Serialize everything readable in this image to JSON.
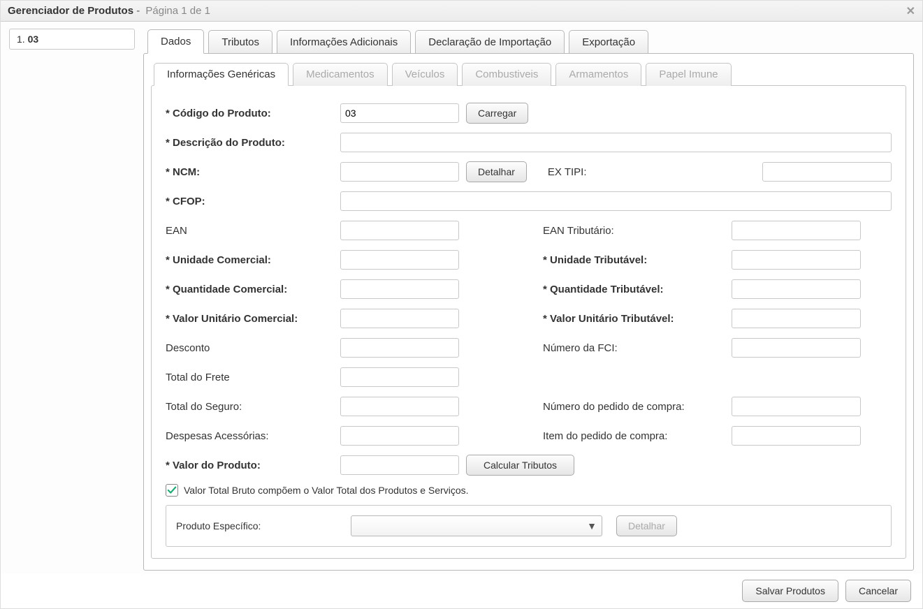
{
  "window": {
    "title": "Gerenciador de Produtos",
    "subtitle": "Página 1 de 1"
  },
  "sidebar": {
    "items": [
      {
        "index": "1.",
        "label": "03"
      }
    ]
  },
  "tabs": {
    "outer": [
      {
        "label": "Dados",
        "active": true
      },
      {
        "label": "Tributos"
      },
      {
        "label": "Informações Adicionais"
      },
      {
        "label": "Declaração de Importação"
      },
      {
        "label": "Exportação"
      }
    ],
    "inner": [
      {
        "label": "Informações Genéricas",
        "active": true
      },
      {
        "label": "Medicamentos",
        "disabled": true
      },
      {
        "label": "Veículos",
        "disabled": true
      },
      {
        "label": "Combustiveis",
        "disabled": true
      },
      {
        "label": "Armamentos",
        "disabled": true
      },
      {
        "label": "Papel Imune",
        "disabled": true
      }
    ]
  },
  "form": {
    "labels": {
      "codigo_produto": "* Código do Produto:",
      "descricao_produto": "* Descrição do Produto:",
      "ncm": "* NCM:",
      "ex_tipi": "EX TIPI:",
      "cfop": "* CFOP:",
      "ean": "EAN",
      "ean_tributario": "EAN Tributário:",
      "unidade_comercial": "* Unidade Comercial:",
      "unidade_tributavel": "* Unidade Tributável:",
      "quantidade_comercial": "* Quantidade Comercial:",
      "quantidade_tributavel": "* Quantidade Tributável:",
      "valor_unitario_comercial": "* Valor Unitário Comercial:",
      "valor_unitario_tributavel": "* Valor Unitário Tributável:",
      "desconto": "Desconto",
      "numero_fci": "Número da FCI:",
      "total_frete": "Total do Frete",
      "total_seguro": "Total do Seguro:",
      "numero_pedido_compra": "Número do pedido de compra:",
      "despesas_acessorias": "Despesas Acessórias:",
      "item_pedido_compra": "Item do pedido de compra:",
      "valor_produto": "* Valor do Produto:",
      "checkbox_bruto": "Valor Total Bruto compõem o Valor Total dos Produtos e Serviços.",
      "produto_especifico": "Produto Específico:"
    },
    "values": {
      "codigo_produto": "03",
      "descricao_produto": "",
      "ncm": "",
      "ex_tipi": "",
      "cfop": "",
      "ean": "",
      "ean_tributario": "",
      "unidade_comercial": "",
      "unidade_tributavel": "",
      "quantidade_comercial": "",
      "quantidade_tributavel": "",
      "valor_unitario_comercial": "",
      "valor_unitario_tributavel": "",
      "desconto": "",
      "numero_fci": "",
      "total_frete": "",
      "total_seguro": "",
      "numero_pedido_compra": "",
      "despesas_acessorias": "",
      "item_pedido_compra": "",
      "valor_produto": "",
      "produto_especifico": ""
    },
    "checkbox_bruto_checked": true
  },
  "buttons": {
    "carregar": "Carregar",
    "detalhar": "Detalhar",
    "calcular_tributos": "Calcular Tributos",
    "detalhar_especifico": "Detalhar",
    "salvar_produtos": "Salvar Produtos",
    "cancelar": "Cancelar"
  }
}
